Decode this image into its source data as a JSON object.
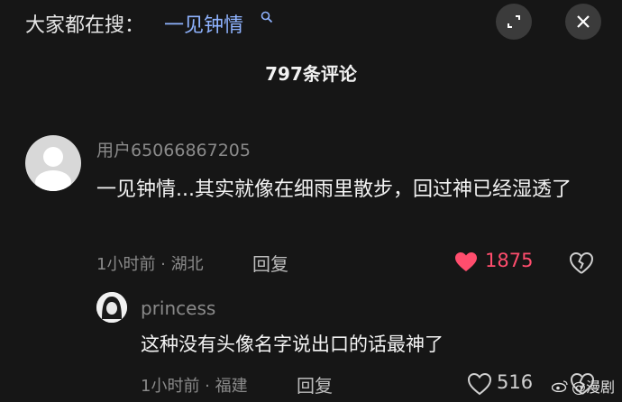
{
  "header": {
    "search_prefix": "大家都在搜：",
    "search_term": "一见钟情",
    "search_icon": "search-icon",
    "expand_icon": "expand-icon",
    "close_icon": "close-icon"
  },
  "comment_count": "797条评论",
  "comments": [
    {
      "username": "用户65066867205",
      "text": "一见钟情...其实就像在细雨里散步，回过神已经湿透了",
      "meta": "1小时前 · 湖北",
      "reply_label": "回复",
      "likes": "1875",
      "liked": true,
      "like_color": "#ff4d6d"
    }
  ],
  "replies": [
    {
      "username": "princess",
      "text": "这种没有头像名字说出口的话最神了",
      "meta": "1小时前 · 福建",
      "reply_label": "回复",
      "likes": "516",
      "liked": false
    }
  ],
  "watermark": "@漫剧"
}
